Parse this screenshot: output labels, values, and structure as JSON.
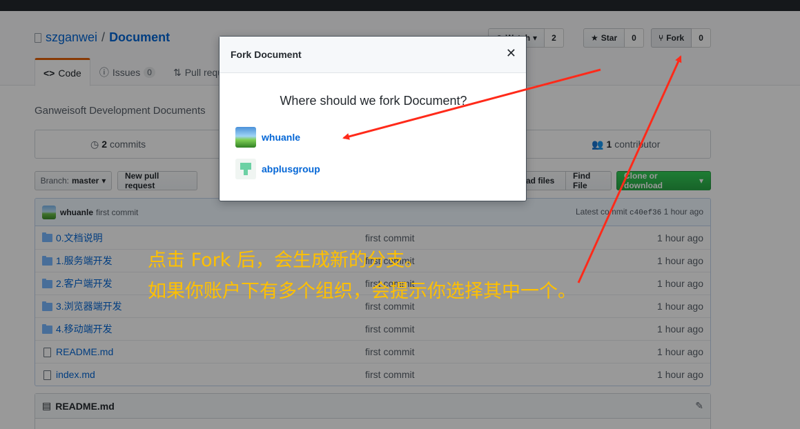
{
  "repo": {
    "owner": "szganwei",
    "name": "Document"
  },
  "actions": {
    "watch_label": "Watch",
    "watch_count": "2",
    "star_label": "Star",
    "star_count": "0",
    "fork_label": "Fork",
    "fork_count": "0"
  },
  "tabs": [
    {
      "label": "Code"
    },
    {
      "label": "Issues",
      "count": "0"
    },
    {
      "label": "Pull reque"
    }
  ],
  "description": "Ganweisoft Development Documents",
  "summary": {
    "commits_count": "2",
    "commits_label": "commits",
    "contributors_count": "1",
    "contributors_label": "contributor"
  },
  "filebar": {
    "branch_label": "Branch:",
    "branch_name": "master",
    "new_pr": "New pull request",
    "upload": "oad files",
    "find_file": "Find File",
    "clone": "Clone or download"
  },
  "commit_tease": {
    "author": "whuanle",
    "message": "first commit",
    "latest_label": "Latest commit",
    "sha": "c40ef36",
    "age": "1 hour ago"
  },
  "files": [
    {
      "name": "0.文档说明",
      "type": "dir",
      "message": "first commit",
      "age": "1 hour ago"
    },
    {
      "name": "1.服务端开发",
      "type": "dir",
      "message": "first commit",
      "age": "1 hour ago"
    },
    {
      "name": "2.客户端开发",
      "type": "dir",
      "message": "first commit",
      "age": "1 hour ago"
    },
    {
      "name": "3.浏览器端开发",
      "type": "dir",
      "message": "first commit",
      "age": "1 hour ago"
    },
    {
      "name": "4.移动端开发",
      "type": "dir",
      "message": "first commit",
      "age": "1 hour ago"
    },
    {
      "name": "README.md",
      "type": "file",
      "message": "first commit",
      "age": "1 hour ago"
    },
    {
      "name": "index.md",
      "type": "file",
      "message": "first commit",
      "age": "1 hour ago"
    }
  ],
  "readme": {
    "title": "README.md"
  },
  "modal": {
    "title": "Fork Document",
    "question": "Where should we fork Document?",
    "options": [
      {
        "name": "whuanle"
      },
      {
        "name": "abplusgroup"
      }
    ]
  },
  "annotation": {
    "line1": "点击 Fork 后，会生成新的分支。",
    "line2": "如果你账户下有多个组织，会提示你选择其中一个。",
    "color": "#ffc000",
    "arrow_color": "#ff2a1a"
  }
}
